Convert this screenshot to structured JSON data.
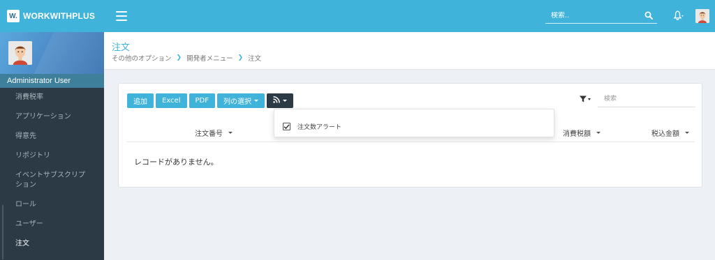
{
  "app": {
    "logo_mark": "W.",
    "name": "WORKWITHPLUS"
  },
  "topbar": {
    "search_placeholder": "検索.."
  },
  "sidebar": {
    "user_name": "Administrator User",
    "items": [
      {
        "label": "消費税率",
        "active": false
      },
      {
        "label": "アプリケーション",
        "active": false
      },
      {
        "label": "得意先",
        "active": false
      },
      {
        "label": "リポジトリ",
        "active": false
      },
      {
        "label": "イベントサブスクリプション",
        "active": false
      },
      {
        "label": "ロール",
        "active": false
      },
      {
        "label": "ユーザー",
        "active": false
      },
      {
        "label": "注文",
        "active": true
      }
    ]
  },
  "page": {
    "title": "注文",
    "breadcrumb": [
      "その他のオプション",
      "開発者メニュー",
      "注文"
    ]
  },
  "toolbar": {
    "add": "追加",
    "excel": "Excel",
    "pdf": "PDF",
    "columns": "列の選択"
  },
  "table_search": {
    "placeholder": "検索"
  },
  "table": {
    "columns": [
      "注文番号",
      "消費税額",
      "税込金額"
    ],
    "empty_message": "レコードがありません。"
  },
  "dropdown": {
    "items": [
      {
        "label": "注文数アラート",
        "checked": true
      }
    ]
  },
  "colors": {
    "accent": "#3fb3da",
    "dark": "#2b3a44",
    "background": "#edf1f5"
  }
}
